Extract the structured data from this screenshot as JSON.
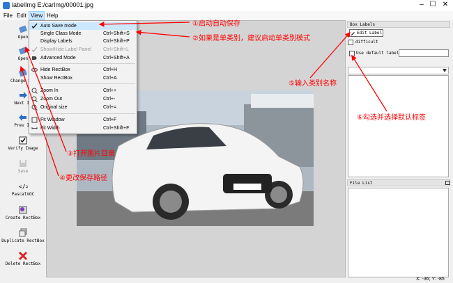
{
  "window": {
    "title": "labelImg E:/carImg/00001.jpg"
  },
  "menubar": {
    "file": "File",
    "edit": "Edit",
    "view": "View",
    "help": "Help"
  },
  "toolbar": {
    "open": "Open",
    "open_dir": "Open",
    "change_save_dir": "Change Sav",
    "next_image": "Next Im",
    "prev_image": "Prev Im",
    "verify_image": "Verify Image",
    "save": "Save",
    "pascal_voc": "PascalVOC",
    "create_rectbox": "Create RectBox",
    "duplicate_rectbox": "Duplicate RectBox",
    "delete_rectbox": "Delete RectBox"
  },
  "view_menu": {
    "auto_save": "Auto Save mode",
    "single_class": {
      "label": "Single Class Mode",
      "shortcut": "Ctrl+Shift+S"
    },
    "display_labels": {
      "label": "Display Labels",
      "shortcut": "Ctrl+Shift+P"
    },
    "show_hide_panel": {
      "label": "Show/Hide Label Panel",
      "shortcut": "Ctrl+Shift+L"
    },
    "advanced_mode": {
      "label": "Advanced Mode",
      "shortcut": "Ctrl+Shift+A"
    },
    "hide_rectbox": {
      "label": "Hide RectBox",
      "shortcut": "Ctrl+H"
    },
    "show_rectbox": {
      "label": "Show RectBox",
      "shortcut": "Ctrl+A"
    },
    "zoom_in": {
      "label": "Zoom In",
      "shortcut": "Ctrl++"
    },
    "zoom_out": {
      "label": "Zoom Out",
      "shortcut": "Ctrl+-"
    },
    "original_size": {
      "label": "Original size",
      "shortcut": "Ctrl+="
    },
    "fit_window": {
      "label": "Fit Window",
      "shortcut": "Ctrl+F"
    },
    "fit_width": {
      "label": "Fit Width",
      "shortcut": "Ctrl+Shift+F"
    }
  },
  "right_panel": {
    "box_labels_title": "Box Labels",
    "edit_label": "Edit Label",
    "difficult": "difficult",
    "use_default_label": "Use default label",
    "file_list_title": "File List"
  },
  "status": {
    "coords": "X: -36; Y: -85"
  },
  "annotations": {
    "a1": "①启动自动保存",
    "a2": "②如果是单类别，建议启动单类别模式",
    "a3": "③打开图片目录",
    "a4": "④更改保存路径",
    "a5": "⑤输入类别名称",
    "a6": "⑥勾选并选择默认标签"
  },
  "colors": {
    "annotation": "#ff0000",
    "menu_highlight": "#cce8ff",
    "canvas_bg": "#d4d4d4"
  }
}
